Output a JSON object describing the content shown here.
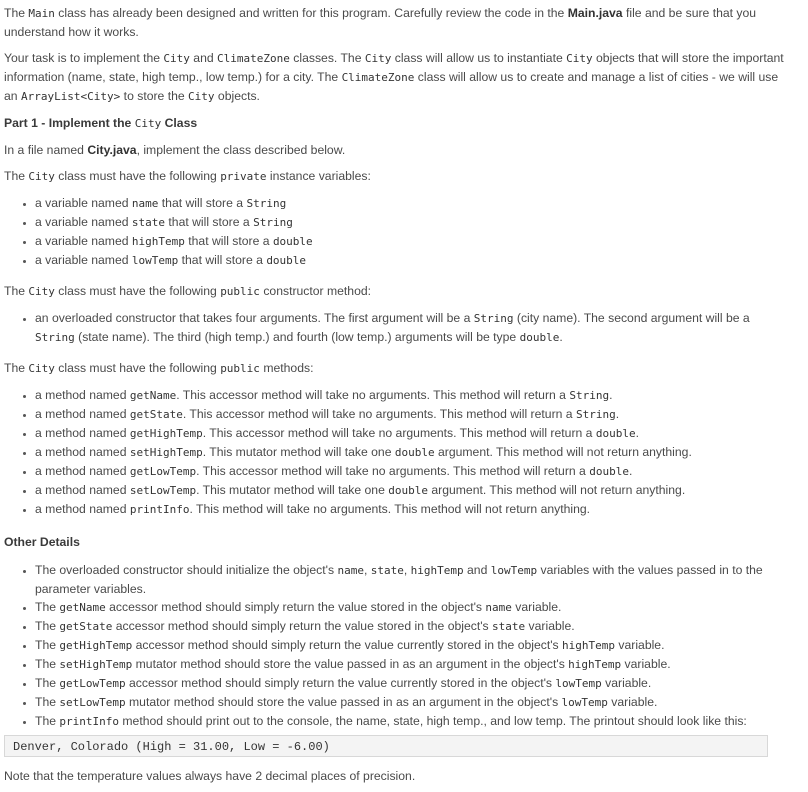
{
  "intro": {
    "p1": [
      "The ",
      "Main",
      " class has already been designed and written for this program. Carefully review the code in the ",
      "Main.java",
      " file and be sure that you understand how it works."
    ],
    "p2": [
      "Your task is to implement the ",
      "City",
      " and ",
      "ClimateZone",
      " classes. The ",
      "City",
      " class will allow us to instantiate ",
      "City",
      " objects that will store the important information (name, state, high temp., low temp.) for a city. The ",
      "ClimateZone",
      " class will allow us to create and manage a list of cities - we will use an ",
      "ArrayList<City>",
      " to store the ",
      "City",
      " objects."
    ]
  },
  "part1": {
    "heading": [
      "Part 1 - Implement the ",
      "City",
      " Class"
    ],
    "file_line": [
      "In a file named ",
      "City.java",
      ", implement the class described below."
    ],
    "vars_intro": [
      "The ",
      "City",
      " class must have the following ",
      "private",
      " instance variables:"
    ],
    "vars": [
      [
        "a variable named ",
        "name",
        " that will store a ",
        "String"
      ],
      [
        "a variable named ",
        "state",
        " that will store a ",
        "String"
      ],
      [
        "a variable named ",
        "highTemp",
        " that will store a ",
        "double"
      ],
      [
        "a variable named ",
        "lowTemp",
        " that will store a ",
        "double"
      ]
    ],
    "ctor_intro": [
      "The ",
      "City",
      " class must have the following ",
      "public",
      " constructor method:"
    ],
    "ctor": [
      "an overloaded constructor that takes four arguments. The first argument will be a ",
      "String",
      " (city name). The second argument will be a ",
      "String",
      " (state name). The third (high temp.) and fourth (low temp.) arguments will be type ",
      "double",
      "."
    ],
    "methods_intro": [
      "The ",
      "City",
      " class must have the following ",
      "public",
      " methods:"
    ],
    "methods": [
      [
        "a method named ",
        "getName",
        ". This accessor method will take no arguments. This method will return a ",
        "String",
        "."
      ],
      [
        "a method named ",
        "getState",
        ". This accessor method will take no arguments. This method will return a ",
        "String",
        "."
      ],
      [
        "a method named ",
        "getHighTemp",
        ". This accessor method will take no arguments. This method will return a ",
        "double",
        "."
      ],
      [
        "a method named ",
        "setHighTemp",
        ". This mutator method will take one ",
        "double",
        " argument. This method will not return anything."
      ],
      [
        "a method named ",
        "getLowTemp",
        ". This accessor method will take no arguments. This method will return a ",
        "double",
        "."
      ],
      [
        "a method named ",
        "setLowTemp",
        ". This mutator method will take one ",
        "double",
        " argument. This method will not return anything."
      ],
      [
        "a method named ",
        "printInfo",
        ". This method will take no arguments. This method will not return anything.",
        "",
        ""
      ]
    ]
  },
  "other": {
    "heading": "Other Details",
    "items": [
      [
        "The overloaded constructor should initialize the object's ",
        "name",
        ", ",
        "state",
        ", ",
        "highTemp",
        " and ",
        "lowTemp",
        " variables with the values passed in to the parameter variables."
      ],
      [
        "The ",
        "getName",
        " accessor method should simply return the value stored in the object's ",
        "name",
        " variable."
      ],
      [
        "The ",
        "getState",
        " accessor method should simply return the value stored in the object's ",
        "state",
        " variable."
      ],
      [
        "The ",
        "getHighTemp",
        " accessor method should simply return the value currently stored in the object's ",
        "highTemp",
        " variable."
      ],
      [
        "The ",
        "setHighTemp",
        " mutator method should store the value passed in as an argument in the object's ",
        "highTemp",
        " variable."
      ],
      [
        "The ",
        "getLowTemp",
        " accessor method should simply return the value currently stored in the object's ",
        "lowTemp",
        " variable."
      ],
      [
        "The ",
        "setLowTemp",
        " mutator method should store the value passed in as an argument in the object's ",
        "lowTemp",
        " variable."
      ],
      [
        "The ",
        "printInfo",
        " method should print out to the console, the name, state, high temp., and low temp. The printout should look like this:",
        "",
        ""
      ]
    ],
    "sample_output": "Denver, Colorado (High = 31.00, Low = -6.00)",
    "note": "Note that the temperature values always have 2 decimal places of precision."
  }
}
